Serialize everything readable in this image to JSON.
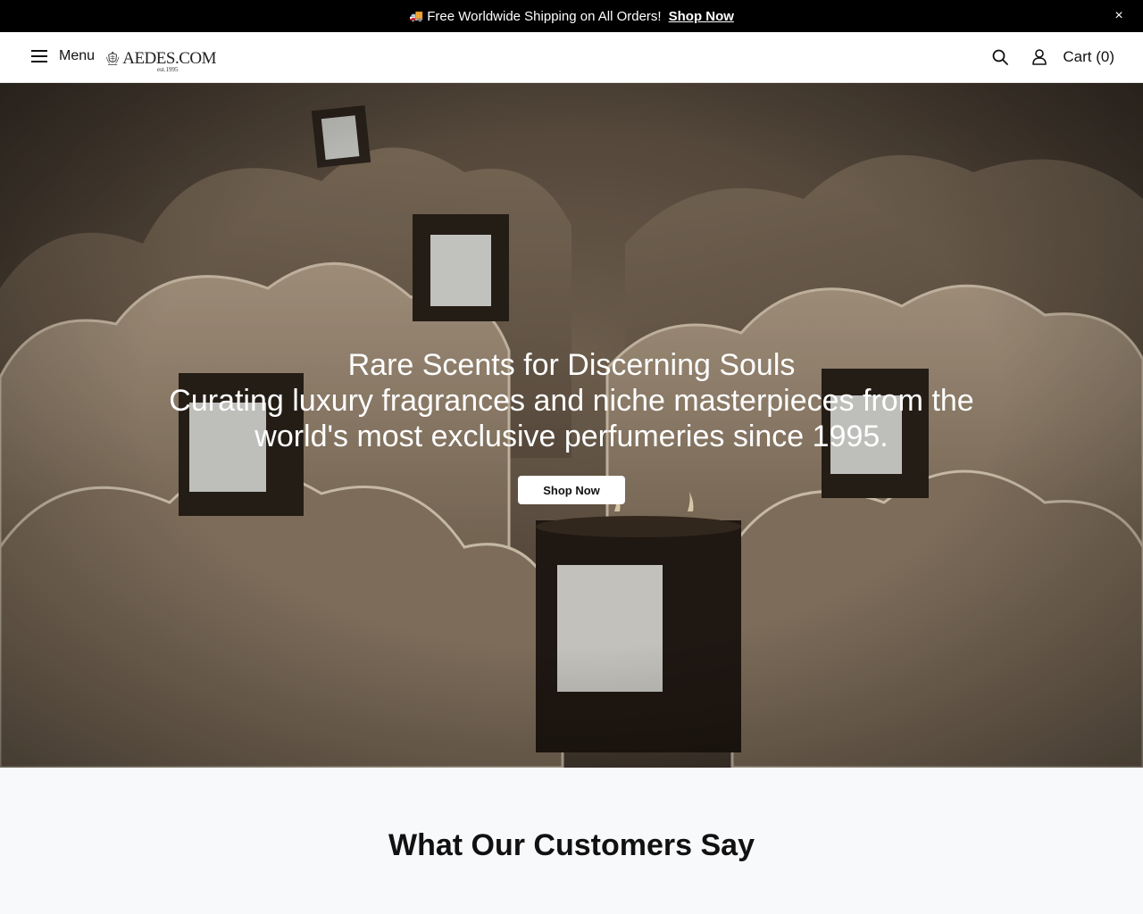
{
  "announcement": {
    "truck_icon": "delivery-truck-icon",
    "message": "Free Worldwide Shipping on All Orders!",
    "link": "Shop Now",
    "close": "×"
  },
  "header": {
    "menu_label": "Menu",
    "logo_text": "AEDES.COM",
    "logo_est": "est.1995",
    "cart_label": "Cart (0)"
  },
  "hero": {
    "title": "Rare Scents for Discerning Souls",
    "subtitle": "Curating luxury fragrances and niche masterpieces from the world's most exclusive perfumeries since 1995.",
    "cta": "Shop Now"
  },
  "testimonials": {
    "heading": "What Our Customers Say"
  }
}
